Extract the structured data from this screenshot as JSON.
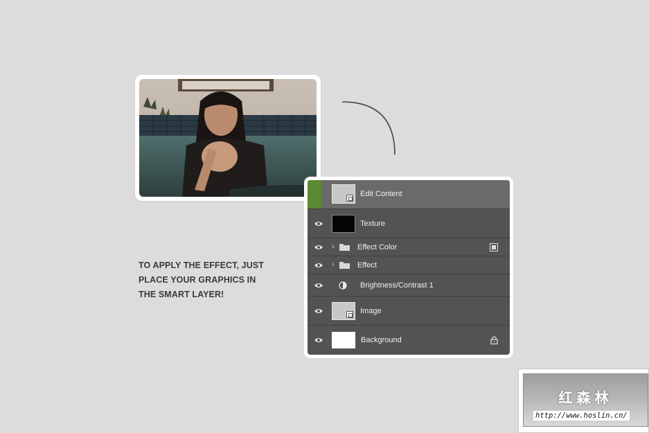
{
  "instructions": {
    "line1": "TO APPLY THE EFFECT, JUST",
    "line2": "PLACE YOUR GRAPHICS IN",
    "line3": "THE SMART LAYER!"
  },
  "layers": [
    {
      "name": "Edit Content",
      "thumbnail": "smart-object",
      "selected": true,
      "visible": true
    },
    {
      "name": "Texture",
      "thumbnail": "dark-texture",
      "visible": true
    },
    {
      "name": "Effect Color",
      "type": "group",
      "badge": "clipping-icon",
      "visible": true
    },
    {
      "name": "Effect",
      "type": "group",
      "visible": true
    },
    {
      "name": "Brightness/Contrast 1",
      "type": "adjustment",
      "visible": true
    },
    {
      "name": "Image",
      "thumbnail": "smart-object",
      "visible": true
    },
    {
      "name": "Background",
      "thumbnail": "white",
      "locked": true,
      "visible": true
    }
  ],
  "colors": {
    "background": "#dcdcdc",
    "panel": "#535353",
    "selected_row": "#6a6a6a",
    "selected_accent": "#5a8a32",
    "text_dark": "#3a3a3a"
  },
  "watermark": {
    "title": "红森林",
    "url": "http://www.hoslin.cn/"
  }
}
